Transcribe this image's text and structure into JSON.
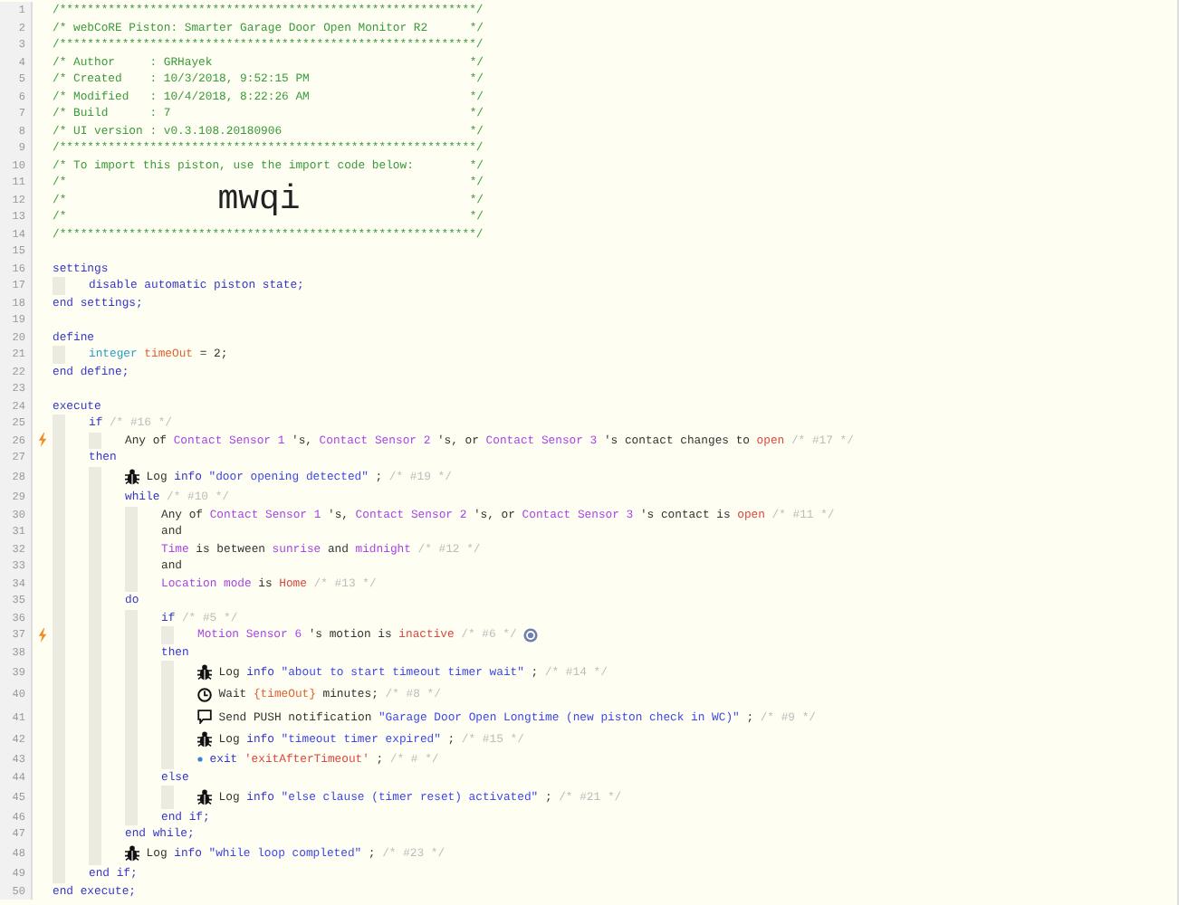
{
  "editor": {
    "lines": [
      {
        "number": "1",
        "trigger": false,
        "segments": [
          {
            "kind": "comment",
            "text": "/************************************************************/"
          }
        ]
      },
      {
        "number": "2",
        "trigger": false,
        "segments": [
          {
            "kind": "comment",
            "text": "/* webCoRE Piston: Smarter Garage Door Open Monitor R2"
          },
          {
            "kind": "comment",
            "text": "*/"
          }
        ]
      },
      {
        "number": "3",
        "trigger": false,
        "segments": [
          {
            "kind": "comment",
            "text": "/************************************************************/"
          }
        ]
      },
      {
        "number": "4",
        "trigger": false,
        "segments": [
          {
            "kind": "comment",
            "text": "/* Author     : GRHayek"
          },
          {
            "kind": "comment",
            "text": "*/"
          }
        ]
      },
      {
        "number": "5",
        "trigger": false,
        "segments": [
          {
            "kind": "comment",
            "text": "/* Created    : 10/3/2018, 9:52:15 PM"
          },
          {
            "kind": "comment",
            "text": "*/"
          }
        ]
      },
      {
        "number": "6",
        "trigger": false,
        "segments": [
          {
            "kind": "comment",
            "text": "/* Modified   : 10/4/2018, 8:22:26 AM"
          },
          {
            "kind": "comment",
            "text": "*/"
          }
        ]
      },
      {
        "number": "7",
        "trigger": false,
        "segments": [
          {
            "kind": "comment",
            "text": "/* Build      : 7"
          },
          {
            "kind": "comment",
            "text": "*/"
          }
        ]
      },
      {
        "number": "8",
        "trigger": false,
        "segments": [
          {
            "kind": "comment",
            "text": "/* UI version : v0.3.108.20180906"
          },
          {
            "kind": "comment",
            "text": "*/"
          }
        ]
      },
      {
        "number": "9",
        "trigger": false,
        "segments": [
          {
            "kind": "comment",
            "text": "/************************************************************/"
          }
        ]
      },
      {
        "number": "10",
        "trigger": false,
        "segments": [
          {
            "kind": "comment",
            "text": "/* To import this piston, use the import code below:"
          },
          {
            "kind": "comment",
            "text": "*/"
          }
        ]
      },
      {
        "number": "11",
        "trigger": false,
        "segments": [
          {
            "kind": "comment",
            "text": "/*"
          },
          {
            "kind": "comment",
            "text": "*/"
          }
        ]
      },
      {
        "number": "12",
        "trigger": false,
        "segments": [
          {
            "kind": "comment",
            "text": "/*"
          },
          {
            "kind": "code",
            "text": "mwqi"
          },
          {
            "kind": "comment",
            "text": "*/"
          }
        ]
      },
      {
        "number": "13",
        "trigger": false,
        "segments": [
          {
            "kind": "comment",
            "text": "/*"
          },
          {
            "kind": "comment",
            "text": "*/"
          }
        ]
      },
      {
        "number": "14",
        "trigger": false,
        "segments": [
          {
            "kind": "comment",
            "text": "/************************************************************/"
          }
        ]
      },
      {
        "number": "15",
        "trigger": false
      },
      {
        "number": "16",
        "trigger": false,
        "segments": [
          {
            "kind": "keyword",
            "text": "settings"
          }
        ],
        "children": [
          {
            "number": "17",
            "trigger": false,
            "segments": [
              {
                "kind": "keyword",
                "text": "disable automatic piston state;"
              }
            ]
          }
        ]
      },
      {
        "number": "18",
        "trigger": false,
        "segments": [
          {
            "kind": "keyword",
            "text": "end settings;"
          }
        ]
      },
      {
        "number": "19",
        "trigger": false
      },
      {
        "number": "20",
        "trigger": false,
        "segments": [
          {
            "kind": "keyword",
            "text": "define"
          }
        ],
        "children": [
          {
            "number": "21",
            "trigger": false,
            "segments": [
              {
                "kind": "type",
                "text": "integer"
              },
              {
                "kind": "variable",
                "text": "timeOut"
              },
              {
                "kind": "text",
                "text": "= 2;"
              }
            ]
          }
        ]
      },
      {
        "number": "22",
        "trigger": false,
        "segments": [
          {
            "kind": "keyword",
            "text": "end define;"
          }
        ]
      },
      {
        "number": "23",
        "trigger": false
      },
      {
        "number": "24",
        "trigger": false,
        "segments": [
          {
            "kind": "keyword",
            "text": "execute"
          }
        ],
        "children": [
          {
            "number": "25",
            "trigger": false,
            "segments": [
              {
                "kind": "keyword",
                "text": "if"
              },
              {
                "kind": "note",
                "text": "/* #16 */"
              }
            ],
            "children": [
              {
                "number": "26",
                "trigger": true,
                "segments": [
                  {
                    "kind": "text",
                    "text": "Any of"
                  },
                  {
                    "kind": "device",
                    "text": "Contact Sensor 1"
                  },
                  {
                    "kind": "text",
                    "text": "'s,"
                  },
                  {
                    "kind": "device",
                    "text": "Contact Sensor 2"
                  },
                  {
                    "kind": "text",
                    "text": "'s, or"
                  },
                  {
                    "kind": "device",
                    "text": "Contact Sensor 3"
                  },
                  {
                    "kind": "text",
                    "text": "'s contact changes to"
                  },
                  {
                    "kind": "value",
                    "text": "open"
                  },
                  {
                    "kind": "note",
                    "text": "/* #17 */"
                  }
                ]
              }
            ]
          },
          {
            "number": "27",
            "trigger": false,
            "segments": [
              {
                "kind": "keyword",
                "text": "then"
              }
            ],
            "children": [
              {
                "number": "28",
                "trigger": false,
                "segments": [
                  {
                    "kind": "bug"
                  },
                  {
                    "kind": "text",
                    "text": "Log"
                  },
                  {
                    "kind": "keyword",
                    "text": "info"
                  },
                  {
                    "kind": "string",
                    "text": "\"door opening detected\""
                  },
                  {
                    "kind": "text",
                    "text": ";"
                  },
                  {
                    "kind": "note",
                    "text": "/* #19 */"
                  }
                ]
              },
              {
                "number": "29",
                "trigger": false,
                "segments": [
                  {
                    "kind": "keyword",
                    "text": "while"
                  },
                  {
                    "kind": "note",
                    "text": "/* #10 */"
                  }
                ],
                "children": [
                  {
                    "number": "30",
                    "trigger": false,
                    "segments": [
                      {
                        "kind": "text",
                        "text": "Any of"
                      },
                      {
                        "kind": "device",
                        "text": "Contact Sensor 1"
                      },
                      {
                        "kind": "text",
                        "text": "'s,"
                      },
                      {
                        "kind": "device",
                        "text": "Contact Sensor 2"
                      },
                      {
                        "kind": "text",
                        "text": "'s, or"
                      },
                      {
                        "kind": "device",
                        "text": "Contact Sensor 3"
                      },
                      {
                        "kind": "text",
                        "text": "'s contact is"
                      },
                      {
                        "kind": "value",
                        "text": "open"
                      },
                      {
                        "kind": "note",
                        "text": "/* #11 */"
                      }
                    ]
                  },
                  {
                    "number": "31",
                    "trigger": false,
                    "segments": [
                      {
                        "kind": "text",
                        "text": "and"
                      }
                    ]
                  },
                  {
                    "number": "32",
                    "trigger": false,
                    "segments": [
                      {
                        "kind": "device",
                        "text": "Time"
                      },
                      {
                        "kind": "text",
                        "text": "is between"
                      },
                      {
                        "kind": "device",
                        "text": "sunrise"
                      },
                      {
                        "kind": "text",
                        "text": "and"
                      },
                      {
                        "kind": "device",
                        "text": "midnight"
                      },
                      {
                        "kind": "note",
                        "text": "/* #12 */"
                      }
                    ]
                  },
                  {
                    "number": "33",
                    "trigger": false,
                    "segments": [
                      {
                        "kind": "text",
                        "text": "and"
                      }
                    ]
                  },
                  {
                    "number": "34",
                    "trigger": false,
                    "segments": [
                      {
                        "kind": "device",
                        "text": "Location mode"
                      },
                      {
                        "kind": "text",
                        "text": "is"
                      },
                      {
                        "kind": "value",
                        "text": "Home"
                      },
                      {
                        "kind": "note",
                        "text": "/* #13 */"
                      }
                    ]
                  }
                ]
              },
              {
                "number": "35",
                "trigger": false,
                "segments": [
                  {
                    "kind": "keyword",
                    "text": "do"
                  }
                ],
                "children": [
                  {
                    "number": "36",
                    "trigger": false,
                    "segments": [
                      {
                        "kind": "keyword",
                        "text": "if"
                      },
                      {
                        "kind": "note",
                        "text": "/* #5 */"
                      }
                    ],
                    "children": [
                      {
                        "number": "37",
                        "trigger": true,
                        "segments": [
                          {
                            "kind": "device",
                            "text": "Motion Sensor 6"
                          },
                          {
                            "kind": "text",
                            "text": "'s motion is"
                          },
                          {
                            "kind": "value",
                            "text": "inactive"
                          },
                          {
                            "kind": "note",
                            "text": "/* #6 */"
                          },
                          {
                            "kind": "gear"
                          }
                        ]
                      }
                    ]
                  },
                  {
                    "number": "38",
                    "trigger": false,
                    "segments": [
                      {
                        "kind": "keyword",
                        "text": "then"
                      }
                    ],
                    "children": [
                      {
                        "number": "39",
                        "trigger": false,
                        "segments": [
                          {
                            "kind": "bug"
                          },
                          {
                            "kind": "text",
                            "text": "Log"
                          },
                          {
                            "kind": "keyword",
                            "text": "info"
                          },
                          {
                            "kind": "string",
                            "text": "\"about to start timeout timer wait\""
                          },
                          {
                            "kind": "text",
                            "text": ";"
                          },
                          {
                            "kind": "note",
                            "text": "/* #14 */"
                          }
                        ]
                      },
                      {
                        "number": "40",
                        "trigger": false,
                        "segments": [
                          {
                            "kind": "clock"
                          },
                          {
                            "kind": "text",
                            "text": "Wait"
                          },
                          {
                            "kind": "variable",
                            "text": "{timeOut}"
                          },
                          {
                            "kind": "text",
                            "text": "minutes;"
                          },
                          {
                            "kind": "note",
                            "text": "/* #8 */"
                          }
                        ]
                      },
                      {
                        "number": "41",
                        "trigger": false,
                        "segments": [
                          {
                            "kind": "chat"
                          },
                          {
                            "kind": "text",
                            "text": "Send PUSH notification"
                          },
                          {
                            "kind": "string",
                            "text": "\"Garage Door Open Longtime (new piston check in WC)\""
                          },
                          {
                            "kind": "text",
                            "text": ";"
                          },
                          {
                            "kind": "note",
                            "text": "/* #9 */"
                          }
                        ]
                      },
                      {
                        "number": "42",
                        "trigger": false,
                        "segments": [
                          {
                            "kind": "bug"
                          },
                          {
                            "kind": "text",
                            "text": "Log"
                          },
                          {
                            "kind": "keyword",
                            "text": "info"
                          },
                          {
                            "kind": "string",
                            "text": "\"timeout timer expired\""
                          },
                          {
                            "kind": "text",
                            "text": ";"
                          },
                          {
                            "kind": "note",
                            "text": "/* #15 */"
                          }
                        ]
                      },
                      {
                        "number": "43",
                        "trigger": false,
                        "segments": [
                          {
                            "kind": "bullet"
                          },
                          {
                            "kind": "keyword",
                            "text": "exit"
                          },
                          {
                            "kind": "value",
                            "text": "'exitAfterTimeout'"
                          },
                          {
                            "kind": "text",
                            "text": ";"
                          },
                          {
                            "kind": "note",
                            "text": "/* # */"
                          }
                        ]
                      }
                    ]
                  },
                  {
                    "number": "44",
                    "trigger": false,
                    "segments": [
                      {
                        "kind": "keyword",
                        "text": "else"
                      }
                    ],
                    "children": [
                      {
                        "number": "45",
                        "trigger": false,
                        "segments": [
                          {
                            "kind": "bug"
                          },
                          {
                            "kind": "text",
                            "text": "Log"
                          },
                          {
                            "kind": "keyword",
                            "text": "info"
                          },
                          {
                            "kind": "string",
                            "text": "\"else clause (timer reset) activated\""
                          },
                          {
                            "kind": "text",
                            "text": ";"
                          },
                          {
                            "kind": "note",
                            "text": "/* #21 */"
                          }
                        ]
                      }
                    ]
                  },
                  {
                    "number": "46",
                    "trigger": false,
                    "segments": [
                      {
                        "kind": "keyword",
                        "text": "end if;"
                      }
                    ]
                  }
                ]
              },
              {
                "number": "47",
                "trigger": false,
                "segments": [
                  {
                    "kind": "keyword",
                    "text": "end while;"
                  }
                ]
              },
              {
                "number": "48",
                "trigger": false,
                "segments": [
                  {
                    "kind": "bug"
                  },
                  {
                    "kind": "text",
                    "text": "Log"
                  },
                  {
                    "kind": "keyword",
                    "text": "info"
                  },
                  {
                    "kind": "string",
                    "text": "\"while loop completed\""
                  },
                  {
                    "kind": "text",
                    "text": ";"
                  },
                  {
                    "kind": "note",
                    "text": "/* #23 */"
                  }
                ]
              }
            ]
          },
          {
            "number": "49",
            "trigger": false,
            "segments": [
              {
                "kind": "keyword",
                "text": "end if;"
              }
            ]
          }
        ]
      },
      {
        "number": "50",
        "trigger": false,
        "segments": [
          {
            "kind": "keyword",
            "text": "end execute;"
          }
        ]
      }
    ]
  }
}
